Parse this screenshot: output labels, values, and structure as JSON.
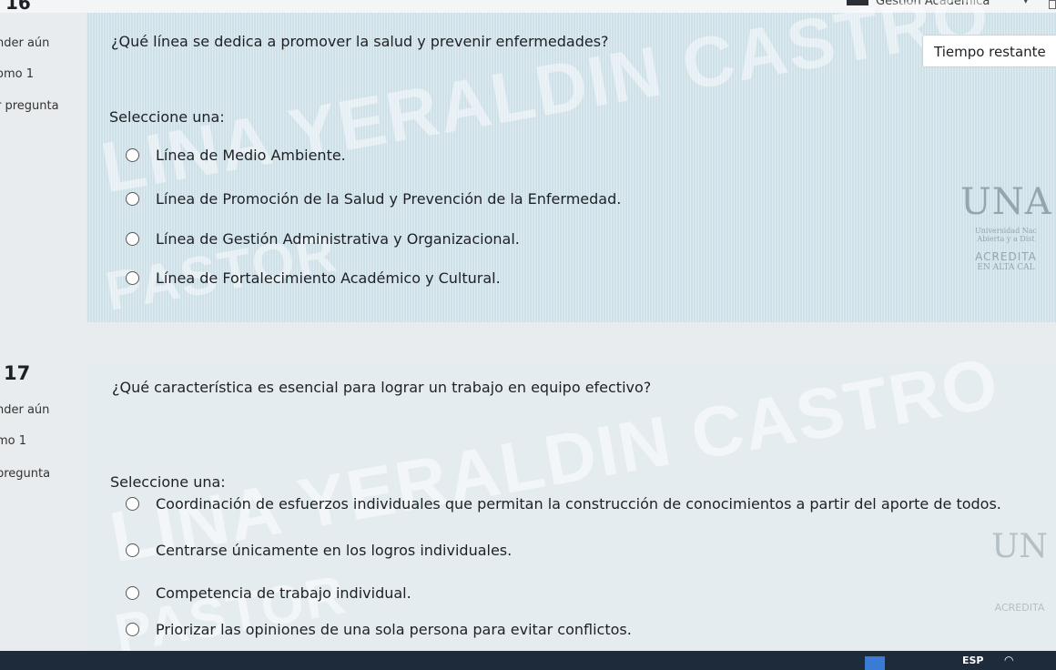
{
  "topbar": {
    "question_number_cut": "16",
    "user_menu": "Gestión Académica"
  },
  "timer": {
    "label": "Tiempo restante"
  },
  "questions": [
    {
      "status_cut": "nder aún",
      "mark_cut": "omo 1",
      "flag_cut": "r pregunta",
      "text": "¿Qué línea se dedica a promover la salud y prevenir enfermedades?",
      "select_label": "Seleccione una:",
      "options": [
        "Línea de Medio Ambiente.",
        "Línea de Promoción de la Salud y Prevención de la Enfermedad.",
        "Línea de Gestión Administrativa y Organizacional.",
        "Línea de Fortalecimiento Académico y Cultural."
      ],
      "watermark_line1": "LINA YERALDIN CASTRO",
      "watermark_line2": "PASTOR",
      "logo_letters": "UNA",
      "logo_sub1": "Universidad Nac",
      "logo_sub2": "Abierta y a Dist",
      "logo_acred": "ACREDITA",
      "logo_acred2": "EN ALTA CAL"
    },
    {
      "number": "17",
      "status_cut": "nder aún",
      "mark_cut": "mo 1",
      "flag_cut": "pregunta",
      "text": "¿Qué característica es esencial para lograr un trabajo en equipo efectivo?",
      "select_label": "Seleccione una:",
      "options": [
        "Coordinación de esfuerzos individuales que permitan la construcción de conocimientos a partir del aporte de todos.",
        "Centrarse únicamente en los logros individuales.",
        "Competencia de trabajo individual.",
        "Priorizar las opiniones de una sola persona para evitar conflictos."
      ],
      "watermark_line1": "LINA YERALDIN CASTRO",
      "watermark_line2": "PASTOR",
      "logo_letters": "UN",
      "logo_acred": "ACREDITA"
    }
  ],
  "taskbar": {
    "language": "ESP"
  }
}
